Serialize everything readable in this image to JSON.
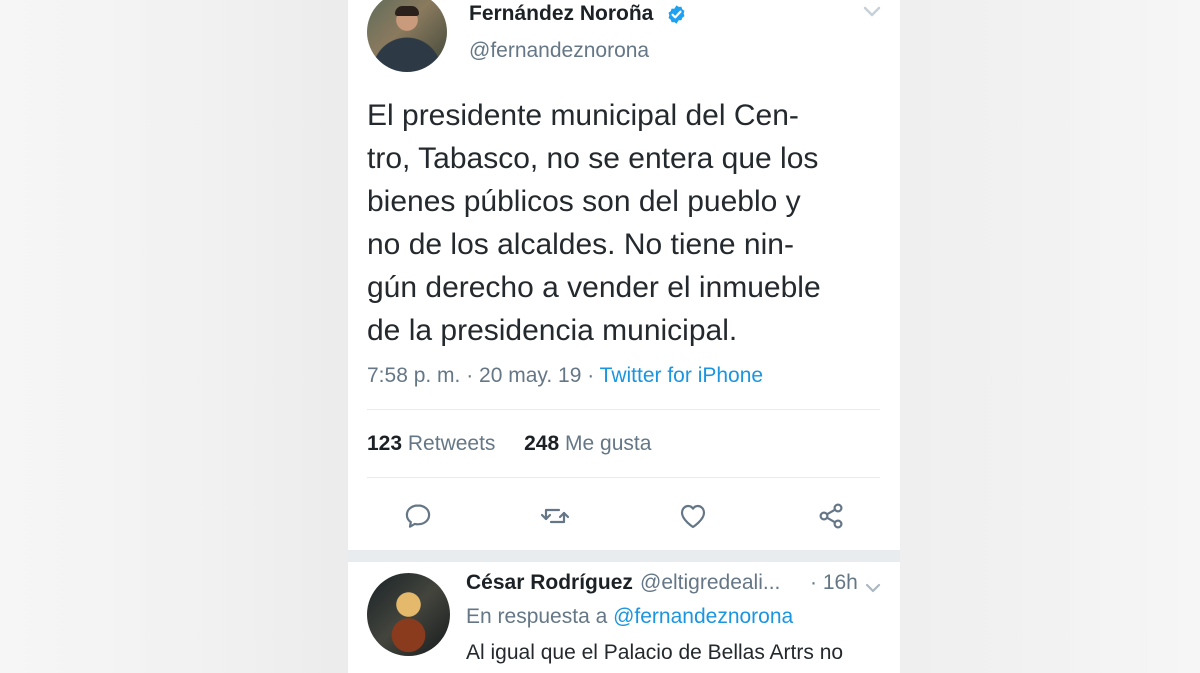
{
  "tweet": {
    "author_name": "Fernández Noroña",
    "author_handle": "@fernandeznorona",
    "verified": true,
    "text_lines": [
      "El presidente municipal del Cen-",
      "tro, Tabasco, no se entera que los",
      "bienes públicos son del pueblo y",
      "no de los alcaldes. No tiene nin-",
      "gún derecho a vender el inmueble",
      "de la presidencia municipal."
    ],
    "timestamp": "7:58 p. m. · 20 may. 19 · ",
    "source": "Twitter for iPhone",
    "retweets_count": "123",
    "retweets_label": "Retweets",
    "likes_count": "248",
    "likes_label": "Me gusta"
  },
  "actions": {
    "reply_icon": "reply-icon",
    "retweet_icon": "retweet-icon",
    "like_icon": "heart-icon",
    "share_icon": "share-icon"
  },
  "reply": {
    "author_name": "César Rodríguez",
    "author_handle": "@eltigredeali...",
    "time": "· 16h",
    "reply_prefix": "En respuesta a ",
    "reply_mention": "@fernandeznorona",
    "text": "Al igual que el Palacio de Bellas Artrs no"
  },
  "colors": {
    "link_blue": "#1b95e0",
    "secondary_text": "#657786",
    "separator": "#e9ecef"
  }
}
